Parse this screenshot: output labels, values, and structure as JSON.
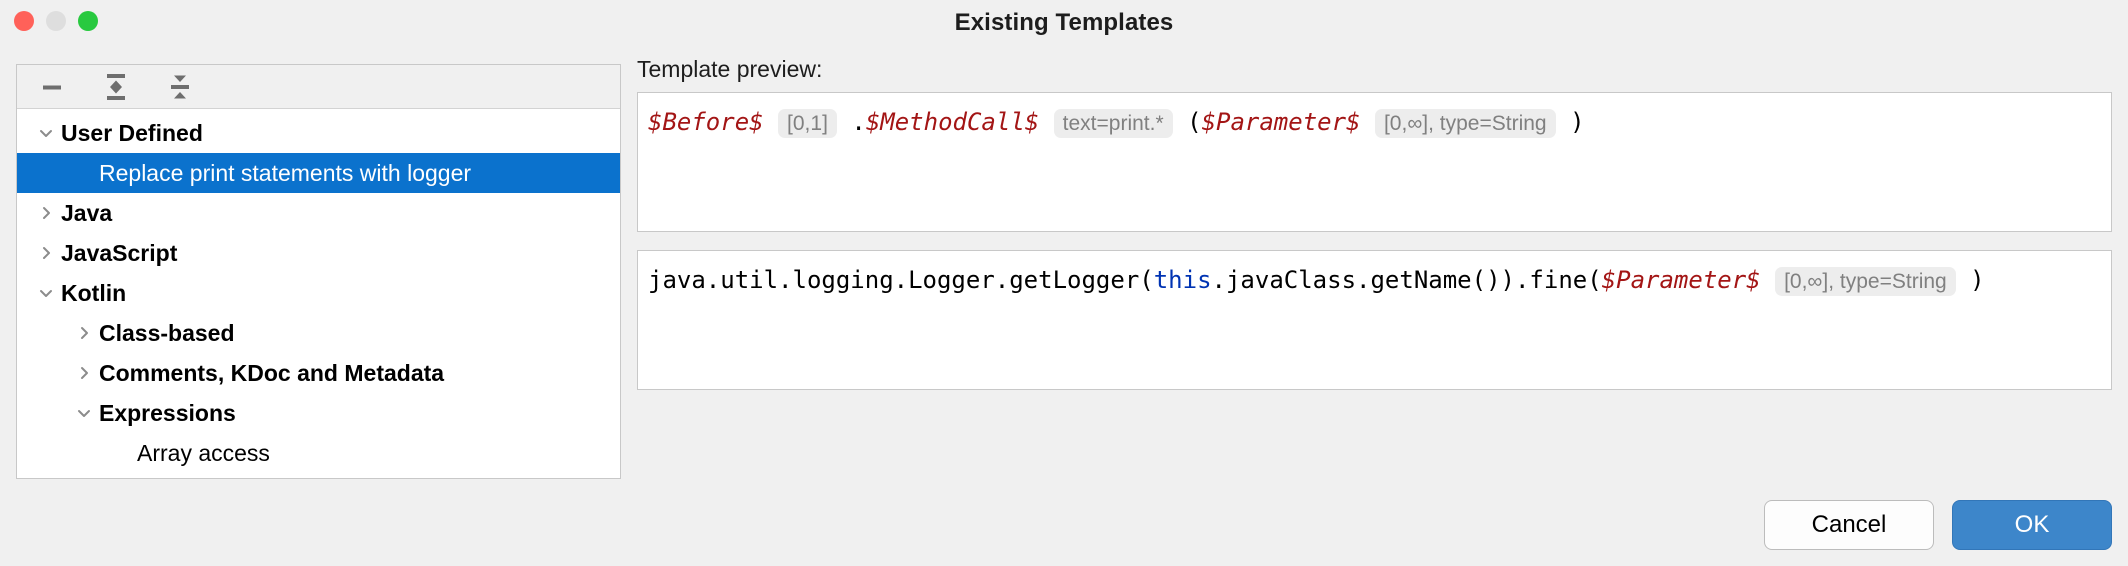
{
  "window": {
    "title": "Existing Templates",
    "traffic_lights": [
      {
        "name": "close",
        "color": "#ff6159"
      },
      {
        "name": "minimize",
        "color": "#dedede"
      },
      {
        "name": "zoom",
        "color": "#28c93f"
      }
    ]
  },
  "tree_toolbar": {
    "buttons": [
      {
        "icon": "remove-icon",
        "label": "Remove"
      },
      {
        "icon": "expand-all-icon",
        "label": "Expand All"
      },
      {
        "icon": "collapse-all-icon",
        "label": "Collapse All"
      }
    ]
  },
  "tree": {
    "items": [
      {
        "label": "User Defined",
        "indent": 0,
        "twisty": "down",
        "bold": true,
        "selected": false
      },
      {
        "label": "Replace print statements with logger",
        "indent": 1,
        "twisty": "none",
        "bold": false,
        "selected": true
      },
      {
        "label": "Java",
        "indent": 0,
        "twisty": "right",
        "bold": true,
        "selected": false
      },
      {
        "label": "JavaScript",
        "indent": 0,
        "twisty": "right",
        "bold": true,
        "selected": false
      },
      {
        "label": "Kotlin",
        "indent": 0,
        "twisty": "down",
        "bold": true,
        "selected": false
      },
      {
        "label": "Class-based",
        "indent": 1,
        "twisty": "right",
        "bold": true,
        "selected": false
      },
      {
        "label": "Comments, KDoc and Metadata",
        "indent": 1,
        "twisty": "right",
        "bold": true,
        "selected": false
      },
      {
        "label": "Expressions",
        "indent": 1,
        "twisty": "down",
        "bold": true,
        "selected": false
      },
      {
        "label": "Array access",
        "indent": 2,
        "twisty": "none",
        "bold": false,
        "selected": false
      }
    ]
  },
  "preview": {
    "caption": "Template preview:",
    "search_tokens": [
      {
        "type": "var",
        "text": "$Before$"
      },
      {
        "type": "chip",
        "text": "[0,1]"
      },
      {
        "type": "plain",
        "text": "."
      },
      {
        "type": "var",
        "text": "$MethodCall$"
      },
      {
        "type": "chip",
        "text": "text=print.*"
      },
      {
        "type": "plain",
        "text": "("
      },
      {
        "type": "var",
        "text": "$Parameter$"
      },
      {
        "type": "chip",
        "text": "[0,∞], type=String"
      },
      {
        "type": "plain",
        "text": ")"
      }
    ],
    "replace_tokens": [
      {
        "type": "plain",
        "text": "java.util.logging.Logger.getLogger("
      },
      {
        "type": "kw",
        "text": "this"
      },
      {
        "type": "plain",
        "text": ".javaClass.getName()).fine("
      },
      {
        "type": "var",
        "text": "$Parameter$"
      },
      {
        "type": "chip",
        "text": "[0,∞], type=String"
      },
      {
        "type": "plain",
        "text": ")"
      }
    ]
  },
  "footer": {
    "cancel_label": "Cancel",
    "ok_label": "OK",
    "accent_color": "#3d86ca"
  }
}
